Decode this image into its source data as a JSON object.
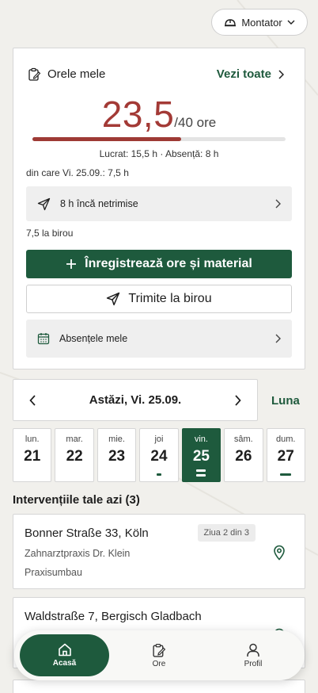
{
  "header": {
    "role": "Montator"
  },
  "hours": {
    "title": "Orele mele",
    "see_all": "Vezi toate",
    "worked_value": "23,5",
    "total_label": "/40 ore",
    "progress_fraction": 0.5875,
    "breakdown": "Lucrat: 15,5 h · Absență: 8 h",
    "from_day": "din care Vi. 25.09.: 7,5 h",
    "unsent": "8 h încă netrimise",
    "office_note": "7,5 la birou",
    "register_button": "Înregistrează ore și material",
    "send_button": "Trimite la birou",
    "absences": "Absențele mele"
  },
  "date_nav": {
    "label": "Astăzi, Vi. 25.09.",
    "month_link": "Luna"
  },
  "week": [
    {
      "name": "lun.",
      "num": "21",
      "mark": "none"
    },
    {
      "name": "mar.",
      "num": "22",
      "mark": "none"
    },
    {
      "name": "mie.",
      "num": "23",
      "mark": "none"
    },
    {
      "name": "joi",
      "num": "24",
      "mark": "short"
    },
    {
      "name": "vin.",
      "num": "25",
      "mark": "double",
      "active": true
    },
    {
      "name": "sâm.",
      "num": "26",
      "mark": "none"
    },
    {
      "name": "dum.",
      "num": "27",
      "mark": "long"
    }
  ],
  "interventions": {
    "title": "Intervențiile tale azi (3)",
    "items": [
      {
        "address": "Bonner Straße 33, Köln",
        "badge": "Ziua 2 din 3",
        "client": "Zahnarztpraxis Dr. Klein",
        "type": "Praxisumbau"
      },
      {
        "address": "Waldstraße 7, Bergisch Gladbach"
      }
    ]
  },
  "bottom_nav": {
    "home": "Acasă",
    "hours": "Ore",
    "profile": "Profil"
  },
  "colors": {
    "brand_green": "#1e5a3d",
    "hours_red": "#a33a36",
    "background": "#f1f0ec"
  }
}
